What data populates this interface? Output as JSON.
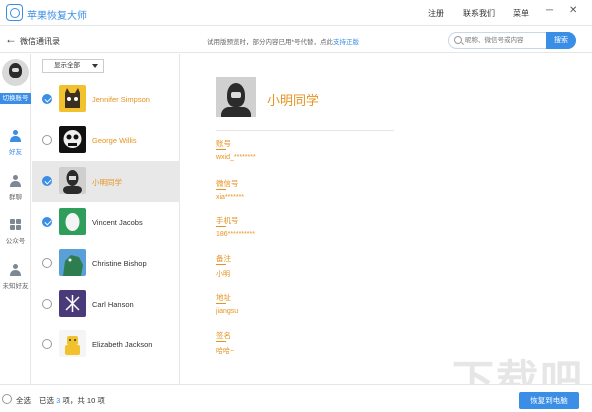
{
  "app": {
    "title": "苹果恢复大师"
  },
  "menu": {
    "register": "注册",
    "contact": "联系我们",
    "menu": "菜单"
  },
  "window": {
    "minimize": "─",
    "close": "✕"
  },
  "subbar": {
    "back": "←",
    "title": "微信通讯录",
    "notice_prefix": "试用版预览时，部分内容已用*号代替，点此",
    "notice_link": "支持正版",
    "search_placeholder": "昵称、微信号或内容",
    "search_button": "搜索"
  },
  "sidebar": {
    "switch_account": "切换账号",
    "items": [
      {
        "label": "好友",
        "icon": "person-icon",
        "active": true
      },
      {
        "label": "群聊",
        "icon": "group-icon",
        "active": false
      },
      {
        "label": "公众号",
        "icon": "grid-icon",
        "active": false
      },
      {
        "label": "未知好友",
        "icon": "unknown-person-icon",
        "active": false
      }
    ]
  },
  "list": {
    "filter": "显示全部",
    "contacts": [
      {
        "name": "Jennifer Simpson",
        "checked": true,
        "orange": true,
        "selected": false
      },
      {
        "name": "George Willis",
        "checked": false,
        "orange": true,
        "selected": false
      },
      {
        "name": "小明同学",
        "checked": true,
        "orange": true,
        "selected": true
      },
      {
        "name": "Vincent Jacobs",
        "checked": true,
        "orange": false,
        "selected": false
      },
      {
        "name": "Christine Bishop",
        "checked": false,
        "orange": false,
        "selected": false
      },
      {
        "name": "Carl Hanson",
        "checked": false,
        "orange": false,
        "selected": false
      },
      {
        "name": "Elizabeth Jackson",
        "checked": false,
        "orange": false,
        "selected": false
      }
    ]
  },
  "detail": {
    "name": "小明同学",
    "fields": [
      {
        "label": "账号",
        "value": "wxid_********"
      },
      {
        "label": "微信号",
        "value": "xia*******"
      },
      {
        "label": "手机号",
        "value": "186**********"
      },
      {
        "label": "备注",
        "value": "小明"
      },
      {
        "label": "地址",
        "value": "jiangsu"
      },
      {
        "label": "签名",
        "value": "哈哈~"
      }
    ]
  },
  "bottom": {
    "select_all": "全选",
    "selected_prefix": "已选 ",
    "selected_count": "3",
    "selected_suffix": " 项，共 10 项",
    "restore_button": "恢复到电脑"
  },
  "watermark": "下载吧"
}
